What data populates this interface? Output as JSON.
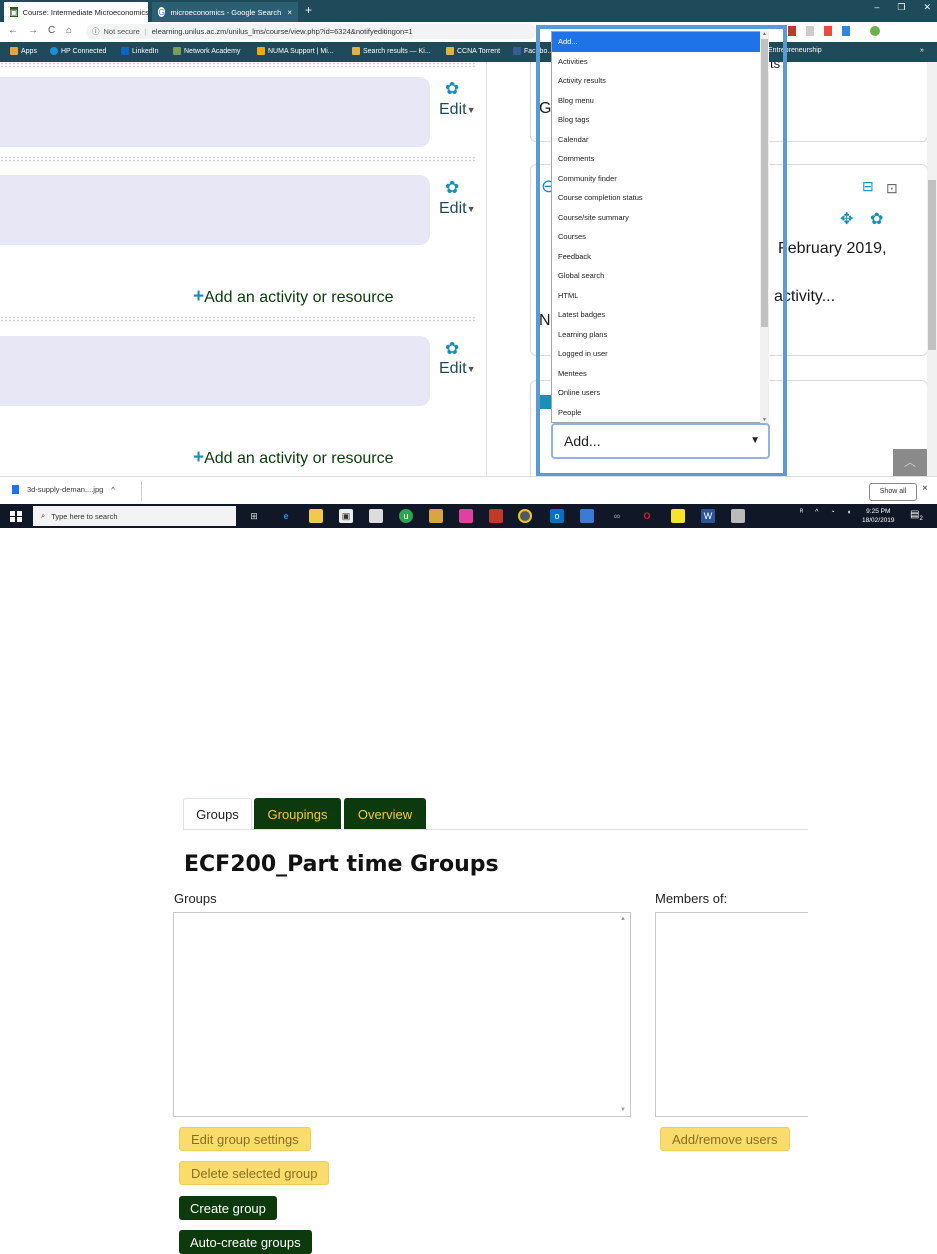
{
  "browser": {
    "tabs": [
      {
        "title": "Course: Intermediate Microeconomics",
        "icon": "moodle-icon",
        "close": "×"
      },
      {
        "title": "microeconomics - Google Search",
        "icon": "google-icon",
        "close": "×"
      }
    ],
    "new_tab": "+",
    "window_controls": [
      "–",
      "❐",
      "✕"
    ],
    "nav": {
      "back": "←",
      "forward": "→",
      "reload": "C",
      "home": "⌂"
    },
    "security": "Not secure",
    "url": "elearning.unilus.ac.zm/unilus_lms/course/view.php?id=6324&notifyeditingon=1",
    "bookmarks": [
      {
        "label": "Apps",
        "color": "#e8a33d"
      },
      {
        "label": "HP Connected",
        "color": "#1a8fd8"
      },
      {
        "label": "LinkedIn",
        "color": "#0a66c2"
      },
      {
        "label": "Network Academy",
        "color": "#7a9b5a"
      },
      {
        "label": "NUMA Support | Mi...",
        "color": "#f2a900"
      },
      {
        "label": "Search results — Ki...",
        "color": "#e0b341"
      },
      {
        "label": "CCNA Torrent",
        "color": "#e0b341"
      },
      {
        "label": "Facebo...",
        "color": "#3b5998"
      },
      {
        "label": "Entrepreneurship",
        "color": "#888888"
      }
    ],
    "more_bookmarks": "»"
  },
  "course": {
    "edit_label": "Edit",
    "add_activity_label": "Add an activity or resource"
  },
  "blocks": {
    "fragment_g": "G",
    "fragment_n": "N",
    "fragment_ts": "ts",
    "date_text": "February 2019,",
    "activity_text": "activity..."
  },
  "add_block": {
    "options": [
      "Add...",
      "Activities",
      "Activity results",
      "Blog menu",
      "Blog tags",
      "Calendar",
      "Comments",
      "Community finder",
      "Course completion status",
      "Course/site summary",
      "Courses",
      "Feedback",
      "Global search",
      "HTML",
      "Latest badges",
      "Learning plans",
      "Logged in user",
      "Mentees",
      "Online users",
      "People"
    ],
    "selected_index": 0,
    "select_value": "Add..."
  },
  "downloads": {
    "file": "3d-supply-deman....jpg",
    "chevron": "^",
    "show_all": "Show all",
    "close": "×"
  },
  "taskbar": {
    "search_placeholder": "Type here to search",
    "time": "9:25 PM",
    "date": "18/02/2019",
    "notification_count": "2"
  },
  "groups_page": {
    "tabs": [
      "Groups",
      "Groupings",
      "Overview"
    ],
    "active_tab": "Groups",
    "title": "ECF200_Part time Groups",
    "groups_label": "Groups",
    "members_label": "Members of:",
    "buttons": {
      "edit_group_settings": "Edit group settings",
      "delete_selected_group": "Delete selected group",
      "create_group": "Create group",
      "auto_create_groups": "Auto-create groups",
      "add_remove_users": "Add/remove users"
    }
  },
  "colors": {
    "chrome_dark": "#1e4a5a",
    "section_bg": "#e8e7f5",
    "moodle_blue": "#1a8fb8",
    "highlight": "#5b9bd5",
    "dropdown_selected": "#1e73e8",
    "tab_dark_green": "#0d3a0d",
    "tab_gold_text": "#f5c842",
    "button_yellow": "#f9dc6c"
  }
}
